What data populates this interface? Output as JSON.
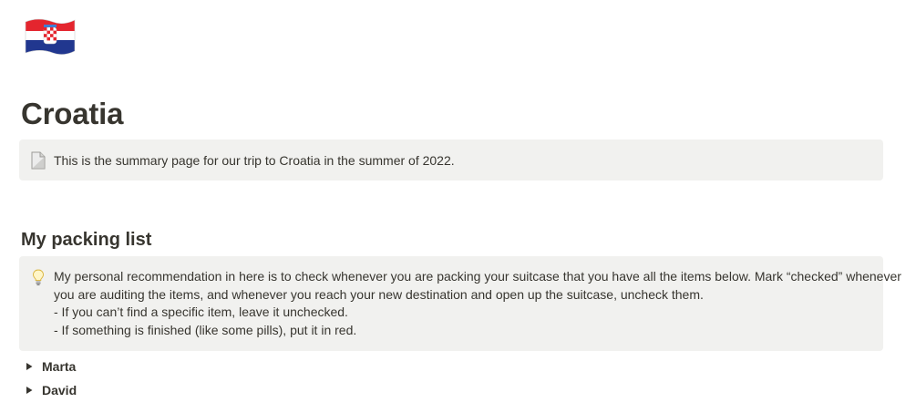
{
  "page": {
    "icon": "croatia-flag-icon",
    "title": "Croatia"
  },
  "summary_callout": {
    "icon": "document-icon",
    "text": "This is the summary page for our trip to Croatia in the summer of 2022."
  },
  "packing_section": {
    "heading": "My packing list",
    "callout": {
      "icon": "lightbulb-icon",
      "lines": [
        "My personal recommendation in here is to check whenever you are packing your suitcase that you have all the items below. Mark “checked” whenever",
        "you are auditing the items, and whenever you reach your new destination and open up the suitcase, uncheck them.",
        "- If you can’t find a specific item, leave it unchecked.",
        "- If something is finished (like some pills), put it in red."
      ]
    },
    "toggles": [
      {
        "label": "Marta",
        "icon": "toggle-triangle-icon"
      },
      {
        "label": "David",
        "icon": "toggle-triangle-icon"
      }
    ]
  },
  "colors": {
    "text": "#37352f",
    "callout_background": "#f1f1ef",
    "flag_red": "#e4252e",
    "flag_blue": "#21378f"
  }
}
